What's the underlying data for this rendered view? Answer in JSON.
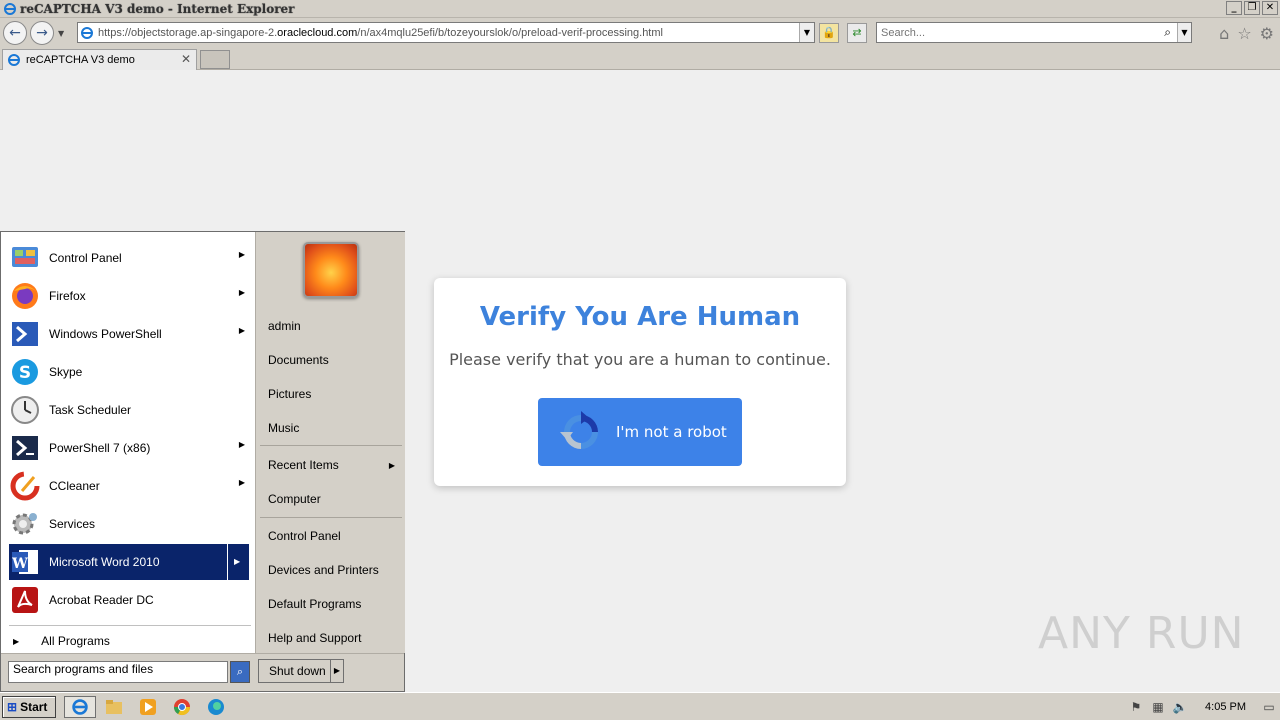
{
  "window": {
    "title": "reCAPTCHA V3 demo - Internet Explorer",
    "controls": {
      "minimize": "_",
      "restore": "❐",
      "close": "✕"
    }
  },
  "navbar": {
    "url_prefix": "https://objectstorage.ap-singapore-2.",
    "url_domain": "oraclecloud.com",
    "url_suffix": "/n/ax4mqlu25efi/b/tozeyourslok/o/preload-verif-processing.html",
    "search_placeholder": "Search..."
  },
  "tabs": [
    {
      "label": "reCAPTCHA V3 demo"
    }
  ],
  "page": {
    "heading": "Verify You Are Human",
    "subtext": "Please verify that you are a human to continue.",
    "button_label": "I'm not a robot",
    "watermark": "ANY RUN",
    "colors": {
      "accent": "#3d82dc",
      "button": "#3d82e8"
    }
  },
  "start_menu": {
    "programs": [
      {
        "label": "Control Panel",
        "icon": "control-panel-icon",
        "arrow": true
      },
      {
        "label": "Firefox",
        "icon": "firefox-icon",
        "arrow": true
      },
      {
        "label": "Windows PowerShell",
        "icon": "powershell-icon",
        "arrow": true
      },
      {
        "label": "Skype",
        "icon": "skype-icon",
        "arrow": false
      },
      {
        "label": "Task Scheduler",
        "icon": "clock-icon",
        "arrow": false
      },
      {
        "label": "PowerShell 7 (x86)",
        "icon": "powershell-icon",
        "arrow": true
      },
      {
        "label": "CCleaner",
        "icon": "ccleaner-icon",
        "arrow": true
      },
      {
        "label": "Services",
        "icon": "gear-icon",
        "arrow": false
      },
      {
        "label": "Microsoft Word 2010",
        "icon": "word-icon",
        "arrow": true,
        "selected": true
      },
      {
        "label": "Acrobat Reader DC",
        "icon": "acrobat-icon",
        "arrow": false
      }
    ],
    "all_programs": "All Programs",
    "search_placeholder": "Search programs and files",
    "shutdown": "Shut down",
    "right_items": {
      "user": "admin",
      "documents": "Documents",
      "pictures": "Pictures",
      "music": "Music",
      "recent": "Recent Items",
      "computer": "Computer",
      "control_panel": "Control Panel",
      "devices": "Devices and Printers",
      "default_programs": "Default Programs",
      "help": "Help and Support"
    }
  },
  "taskbar": {
    "start": "Start",
    "clock": "4:05 PM"
  }
}
